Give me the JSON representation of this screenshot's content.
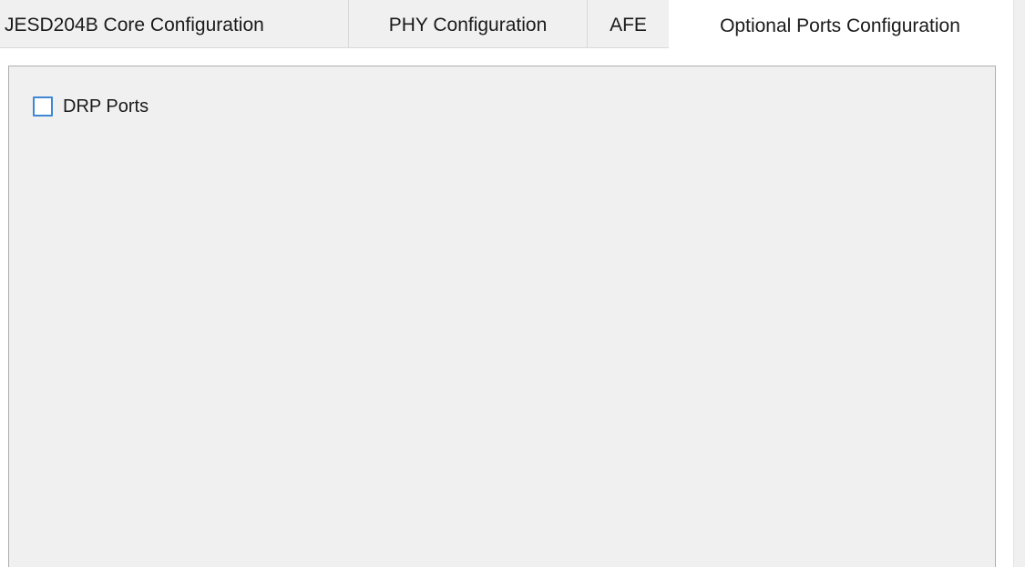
{
  "tabs": [
    {
      "label": "JESD204B Core Configuration",
      "selected": false
    },
    {
      "label": "PHY Configuration",
      "selected": false
    },
    {
      "label": "AFE",
      "selected": false
    },
    {
      "label": "Optional Ports Configuration",
      "selected": true
    }
  ],
  "panel": {
    "drp_ports": {
      "label": "DRP Ports",
      "checked": false
    }
  },
  "colors": {
    "checkbox_border": "#3f86d4",
    "panel_background": "#f0f0f0"
  }
}
